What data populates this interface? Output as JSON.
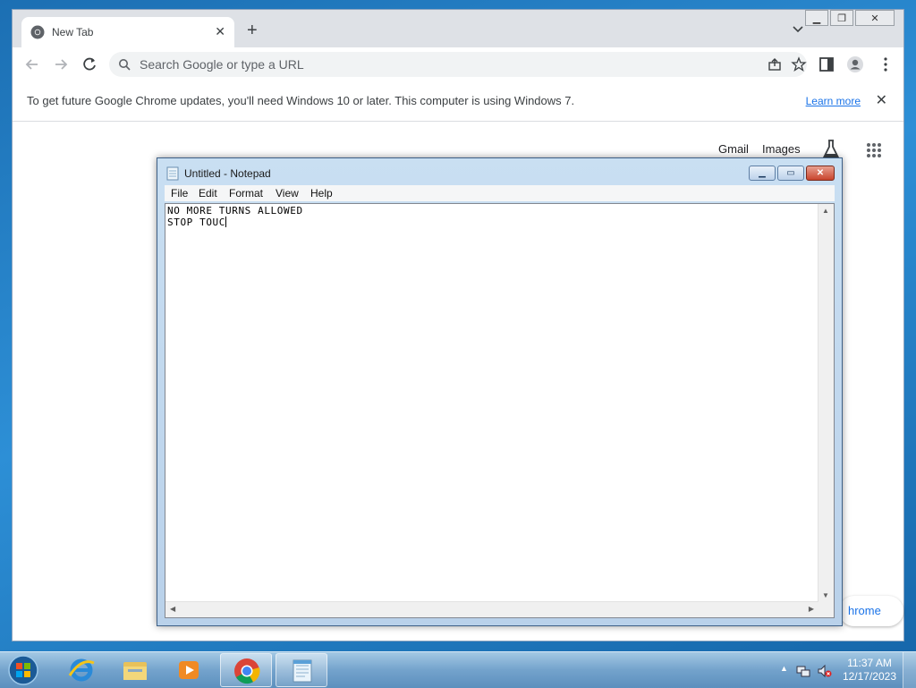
{
  "chrome": {
    "tab_title": "New Tab",
    "omnibox_placeholder": "Search Google or type a URL",
    "infobar_text": "To get future Google Chrome updates, you'll need Windows 10 or later. This computer is using Windows 7.",
    "learn_more": "Learn more",
    "links": {
      "gmail": "Gmail",
      "images": "Images"
    },
    "customize_chip": "hrome"
  },
  "notepad": {
    "title": "Untitled - Notepad",
    "menu": [
      "File",
      "Edit",
      "Format",
      "View",
      "Help"
    ],
    "lines": [
      "NO MORE TURNS ALLOWED",
      "STOP TOUC"
    ]
  },
  "taskbar": {
    "time": "11:37 AM",
    "date": "12/17/2023",
    "pinned": [
      "ie-icon",
      "explorer-icon",
      "media-player-icon",
      "chrome-icon",
      "notepad-icon"
    ]
  },
  "colors": {
    "accent": "#1a73e8",
    "desktop": "#2d8fd6"
  }
}
